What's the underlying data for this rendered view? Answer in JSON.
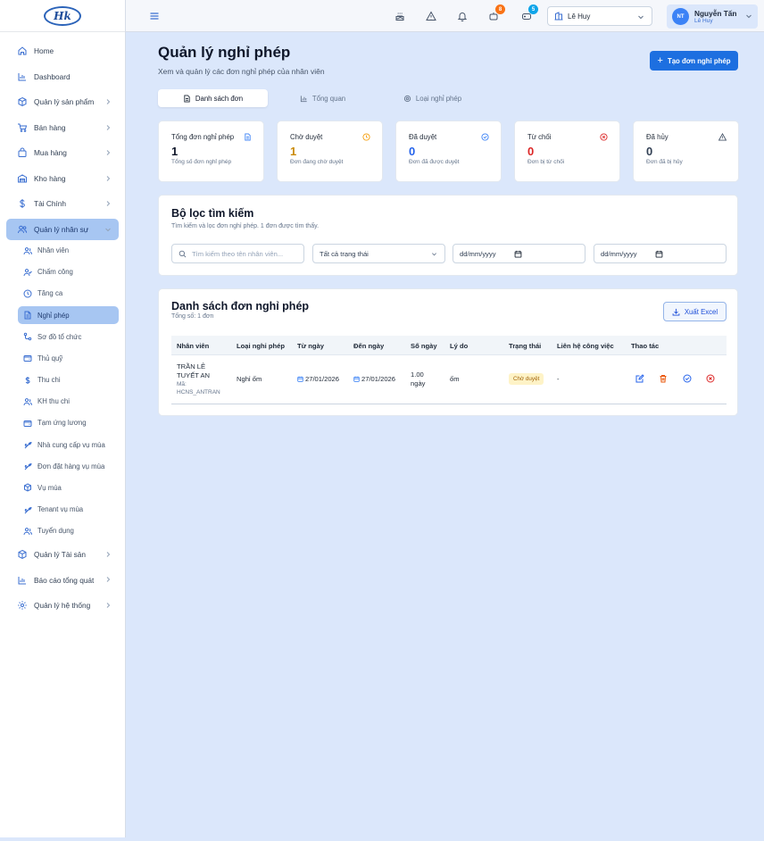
{
  "app": {
    "logo_text": "Hk"
  },
  "sidebar": {
    "items": [
      {
        "label": "Home",
        "icon": "home-icon"
      },
      {
        "label": "Dashboard",
        "icon": "chart-icon"
      },
      {
        "label": "Quản lý sản phẩm",
        "icon": "box-icon"
      },
      {
        "label": "Bán hàng",
        "icon": "cart-icon"
      },
      {
        "label": "Mua hàng",
        "icon": "bag-icon"
      },
      {
        "label": "Kho hàng",
        "icon": "warehouse-icon"
      },
      {
        "label": "Tài Chính",
        "icon": "dollar-icon"
      },
      {
        "label": "Quản lý nhân sự",
        "icon": "users-icon"
      }
    ],
    "sub_items": [
      "Nhân viên",
      "Chấm công",
      "Tăng ca",
      "Nghỉ phép",
      "Sơ đồ tổ chức",
      "Thủ quỹ",
      "Thu chi",
      "KH thu chi",
      "Tạm ứng lương",
      "Nhà cung cấp vụ mùa",
      "Đơn đặt hàng vụ mùa",
      "Vụ mùa",
      "Tenant vụ mùa",
      "Tuyển dụng"
    ],
    "bottom_items": [
      {
        "label": "Quản lý Tài sản"
      },
      {
        "label": "Báo cáo tổng quát"
      },
      {
        "label": "Quản lý hệ thống"
      }
    ]
  },
  "topbar": {
    "badges": {
      "notifications_a": "8",
      "notifications_b": "5"
    },
    "badge_colors": {
      "a": "#f97316",
      "b": "#0ea5e9"
    },
    "store": "Lê Huy",
    "user": {
      "initials": "NT",
      "name": "Nguyễn Tấn",
      "sub": "Lê Huy"
    }
  },
  "page": {
    "title": "Quản lý nghỉ phép",
    "subtitle": "Xem và quản lý các đơn nghỉ phép của nhân viên",
    "create_button": "Tạo đơn nghỉ phép",
    "tabs": [
      "Danh sách đơn",
      "Tổng quan",
      "Loại nghỉ phép"
    ]
  },
  "stats": [
    {
      "label": "Tổng đơn nghỉ phép",
      "value": "1",
      "desc": "Tổng số đơn nghỉ phép",
      "color": "#0f172a"
    },
    {
      "label": "Chờ duyệt",
      "value": "1",
      "desc": "Đơn đang chờ duyệt",
      "color": "#ca8a04"
    },
    {
      "label": "Đã duyệt",
      "value": "0",
      "desc": "Đơn đã được duyệt",
      "color": "#2563eb"
    },
    {
      "label": "Từ chối",
      "value": "0",
      "desc": "Đơn bị từ chối",
      "color": "#dc2626"
    },
    {
      "label": "Đã hủy",
      "value": "0",
      "desc": "Đơn đã bị hủy",
      "color": "#334155"
    }
  ],
  "filter": {
    "title": "Bộ lọc tìm kiếm",
    "subtitle": "Tìm kiếm và lọc đơn nghỉ phép. 1 đơn được tìm thấy.",
    "search_placeholder": "Tìm kiếm theo tên nhân viên...",
    "status_value": "Tất cả trạng thái",
    "from_date": "dd/mm/yyyy",
    "to_date": "dd/mm/yyyy"
  },
  "list": {
    "title": "Danh sách đơn nghỉ phép",
    "total": "Tổng số: 1 đơn",
    "export_button": "Xuất Excel",
    "columns": [
      "Nhân viên",
      "Loại nghỉ phép",
      "Từ ngày",
      "Đến ngày",
      "Số ngày",
      "Lý do",
      "Trạng thái",
      "Liên hệ công việc",
      "Thao tác"
    ],
    "rows": [
      {
        "name_line1": "TRẦN LÊ",
        "name_line2": "TUYẾT AN",
        "code_line1": "Mã:",
        "code_line2": "HCNS_ANTRAN",
        "type": "Nghỉ ốm",
        "from": "27/01/2026",
        "to": "27/01/2026",
        "days_line1": "1.00",
        "days_line2": "ngày",
        "reason": "ốm",
        "status": "Chờ duyệt",
        "contact": "-"
      }
    ]
  }
}
